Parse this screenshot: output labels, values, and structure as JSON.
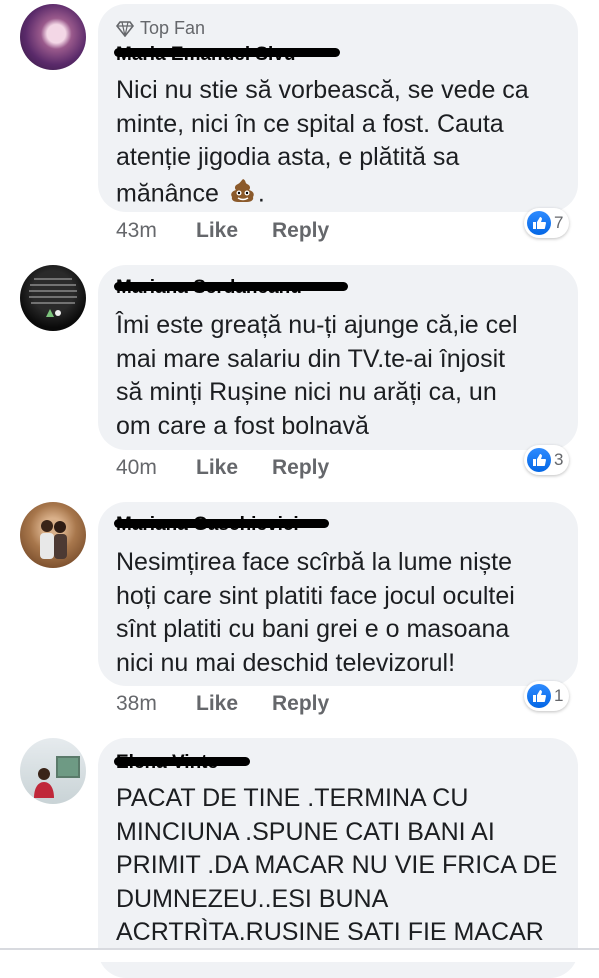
{
  "comments": [
    {
      "badge": "Top Fan",
      "author": "Maria Emanuel Sivu",
      "text": "Nici nu stie să vorbească, se vede ca\nminte, nici în ce spital a fost. Cauta\natenție jigodia asta, e plătită sa\nmănânce",
      "text_suffix": ".",
      "time": "43m",
      "like_label": "Like",
      "reply_label": "Reply",
      "reaction_count": "7"
    },
    {
      "author": "Mariana Serdaneanu",
      "text": "Îmi este greață nu-ți ajunge că,ie cel\nmai mare salariu din TV.te-ai înjosit\nsă minți Rușine nici nu arăți ca, un\nom care a fost bolnavă",
      "time": "40m",
      "like_label": "Like",
      "reply_label": "Reply",
      "reaction_count": "3"
    },
    {
      "author": "Mariana Gaschievici",
      "text": "Nesimțirea face scîrbă la lume niște\nhoți care sint platiti face jocul ocultei\nsînt platiti cu bani grei e o masoana\nnici nu mai deschid televizorul!",
      "time": "38m",
      "like_label": "Like",
      "reply_label": "Reply",
      "reaction_count": "1"
    },
    {
      "author": "Elena Vinte",
      "text": "PACAT DE TINE .TERMINA CU\nMINCIUNA .SPUNE CATI BANI AI\nPRIMIT .DA MACAR NU VIE FRICA DE\nDUMNEZEU..ESI BUNA\nACRTRÌTA.RUSINE SATI FIE MACAR"
    }
  ],
  "colors": {
    "bubble": "#f0f2f5",
    "meta": "#65676b",
    "like_blue": "#1877f2"
  }
}
